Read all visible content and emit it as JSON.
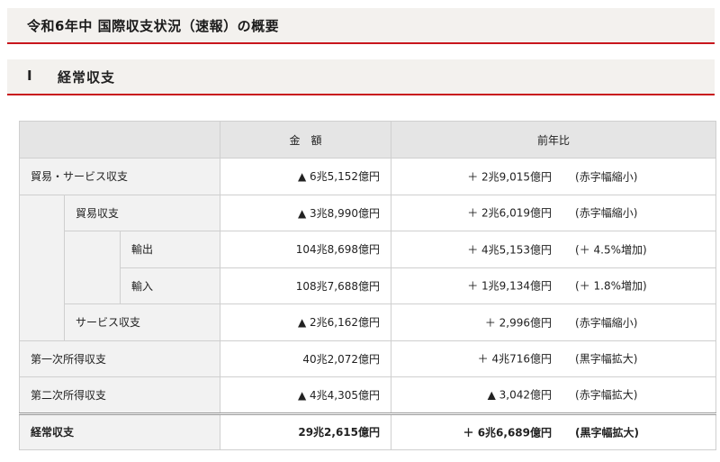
{
  "page_title": "令和6年中 国際収支状況（速報）の概要",
  "section": {
    "number": "Ⅰ",
    "title": "経常収支"
  },
  "table": {
    "headers": {
      "amount": "金　額",
      "yoy": "前年比"
    },
    "rows": [
      {
        "label": "貿易・サービス収支",
        "amount": "▲ 6兆5,152億円",
        "change": "＋ 2兆9,015億円",
        "note": "(赤字幅縮小)"
      },
      {
        "label": "貿易収支",
        "amount": "▲ 3兆8,990億円",
        "change": "＋ 2兆6,019億円",
        "note": "(赤字幅縮小)"
      },
      {
        "label": "輸出",
        "amount": "104兆8,698億円",
        "change": "＋ 4兆5,153億円",
        "note": "(＋ 4.5%増加)"
      },
      {
        "label": "輸入",
        "amount": "108兆7,688億円",
        "change": "＋ 1兆9,134億円",
        "note": "(＋ 1.8%増加)"
      },
      {
        "label": "サービス収支",
        "amount": "▲ 2兆6,162億円",
        "change": "＋ 2,996億円",
        "note": "(赤字幅縮小)"
      },
      {
        "label": "第一次所得収支",
        "amount": "40兆2,072億円",
        "change": "＋ 4兆716億円",
        "note": "(黒字幅拡大)"
      },
      {
        "label": "第二次所得収支",
        "amount": "▲ 4兆4,305億円",
        "change": "▲ 3,042億円",
        "note": "(赤字幅拡大)"
      },
      {
        "label": "経常収支",
        "amount": "29兆2,615億円",
        "change": "＋ 6兆6,689億円",
        "note": "(黒字幅拡大)"
      }
    ]
  }
}
